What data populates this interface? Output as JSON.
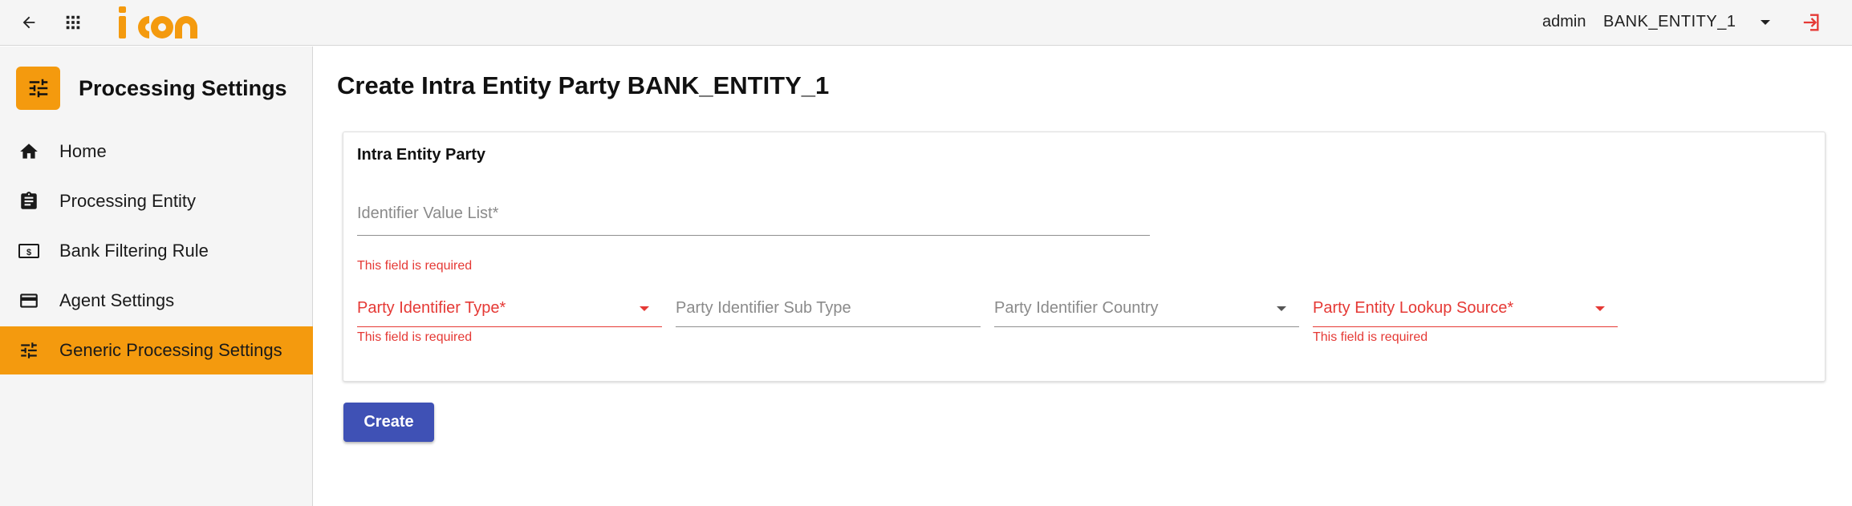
{
  "header": {
    "back_icon": "arrow-left-icon",
    "apps_icon": "grid-icon",
    "logo_text": "icon",
    "user": "admin",
    "entity": "BANK_ENTITY_1",
    "logout_icon": "logout-icon"
  },
  "sidebar": {
    "title": "Processing Settings",
    "items": [
      {
        "label": "Home",
        "icon": "home-icon"
      },
      {
        "label": "Processing Entity",
        "icon": "clipboard-icon"
      },
      {
        "label": "Bank Filtering Rule",
        "icon": "money-icon"
      },
      {
        "label": "Agent Settings",
        "icon": "credit-card-icon"
      },
      {
        "label": "Generic Processing Settings",
        "icon": "tune-icon",
        "active": true
      }
    ]
  },
  "main": {
    "title": "Create Intra Entity Party BANK_ENTITY_1",
    "card_title": "Intra Entity Party",
    "fields": {
      "identifier_value_list": {
        "label": "Identifier Value List*",
        "error": "This field is required"
      },
      "party_identifier_type": {
        "label": "Party Identifier Type*",
        "error": "This field is required"
      },
      "party_identifier_sub_type": {
        "label": "Party Identifier Sub Type"
      },
      "party_identifier_country": {
        "label": "Party Identifier Country"
      },
      "party_entity_lookup_source": {
        "label": "Party Entity Lookup Source*",
        "error": "This field is required"
      }
    },
    "create_label": "Create"
  },
  "colors": {
    "accent": "#f49a0e",
    "primary": "#3f51b5",
    "error": "#e53935"
  }
}
